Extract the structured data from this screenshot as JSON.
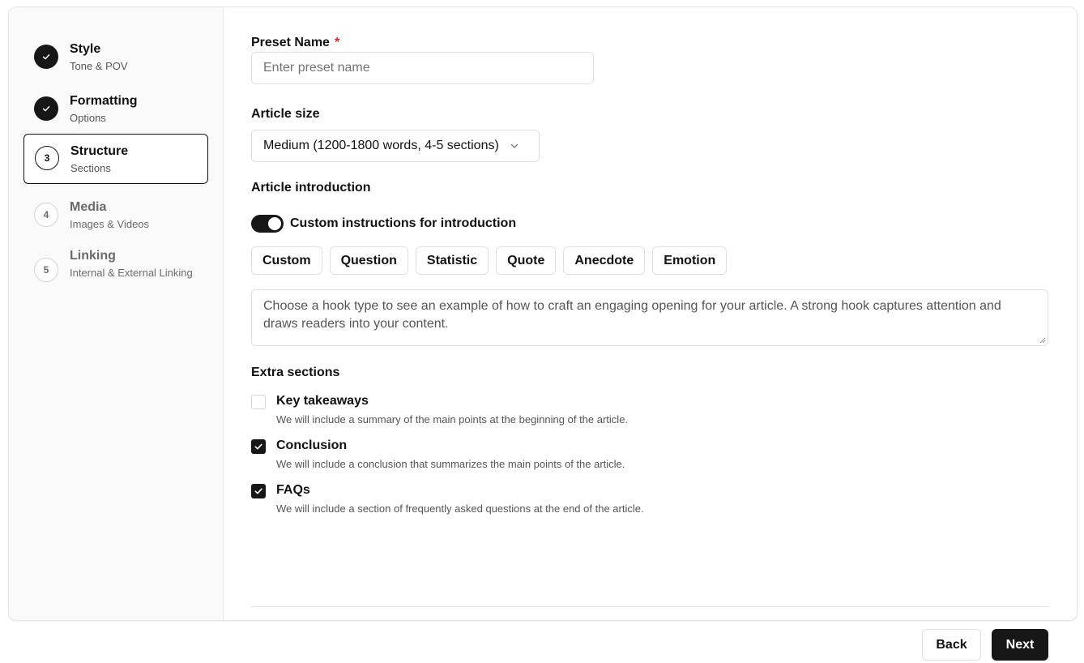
{
  "steps": [
    {
      "number": "1",
      "title": "Style",
      "subtitle": "Tone & POV",
      "state": "done"
    },
    {
      "number": "2",
      "title": "Formatting",
      "subtitle": "Options",
      "state": "done"
    },
    {
      "number": "3",
      "title": "Structure",
      "subtitle": "Sections",
      "state": "active"
    },
    {
      "number": "4",
      "title": "Media",
      "subtitle": "Images & Videos",
      "state": "pending"
    },
    {
      "number": "5",
      "title": "Linking",
      "subtitle": "Internal & External Linking",
      "state": "pending"
    }
  ],
  "preset": {
    "label": "Preset Name",
    "required_mark": "*",
    "placeholder": "Enter preset name",
    "value": ""
  },
  "article_size": {
    "label": "Article size",
    "selected": "Medium (1200-1800 words, 4-5 sections)"
  },
  "introduction": {
    "label": "Article introduction",
    "toggle_label": "Custom instructions for introduction",
    "toggle_on": true,
    "hooks": [
      "Custom",
      "Question",
      "Statistic",
      "Quote",
      "Anecdote",
      "Emotion"
    ],
    "textarea_text": "Choose a hook type to see an example of how to craft an engaging opening for your article. A strong hook captures attention and draws readers into your content."
  },
  "extra_sections": {
    "label": "Extra sections",
    "items": [
      {
        "title": "Key takeaways",
        "description": "We will include a summary of the main points at the beginning of the article.",
        "checked": false
      },
      {
        "title": "Conclusion",
        "description": "We will include a conclusion that summarizes the main points of the article.",
        "checked": true
      },
      {
        "title": "FAQs",
        "description": "We will include a section of frequently asked questions at the end of the article.",
        "checked": true
      }
    ]
  },
  "footer": {
    "back_label": "Back",
    "next_label": "Next"
  }
}
